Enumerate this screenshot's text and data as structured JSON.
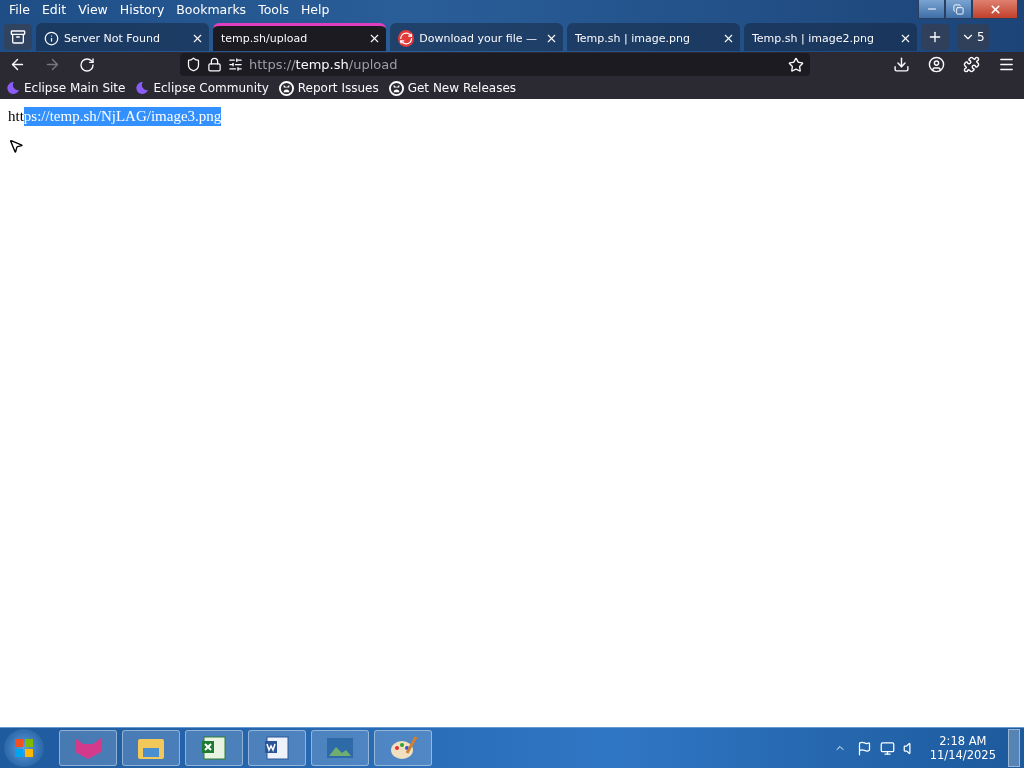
{
  "menu_bar": [
    "File",
    "Edit",
    "View",
    "History",
    "Bookmarks",
    "Tools",
    "Help"
  ],
  "tabs": [
    {
      "label": "Server Not Found",
      "kind": "info",
      "selected": false
    },
    {
      "label": "temp.sh/upload",
      "kind": "plain",
      "selected": true
    },
    {
      "label": "Download your file —",
      "kind": "sync",
      "selected": false
    },
    {
      "label": "Temp.sh | image.png",
      "kind": "plain",
      "selected": false
    },
    {
      "label": "Temp.sh | image2.png",
      "kind": "plain",
      "selected": false
    }
  ],
  "tab_count": "5",
  "address_bar": {
    "prefix": "https://",
    "host": "temp.sh",
    "path": "/upload"
  },
  "bookmarks": [
    {
      "label": "Eclipse Main Site",
      "kind": "eclipse"
    },
    {
      "label": "Eclipse Community",
      "kind": "eclipse"
    },
    {
      "label": "Report Issues",
      "kind": "github"
    },
    {
      "label": "Get New Releases",
      "kind": "github"
    }
  ],
  "page": {
    "text_before_selection": "htt",
    "selected_text": "ps://temp.sh/NjLAG/image3.png"
  },
  "taskbar": {
    "time": "2:18 AM",
    "date": "11/14/2025"
  }
}
